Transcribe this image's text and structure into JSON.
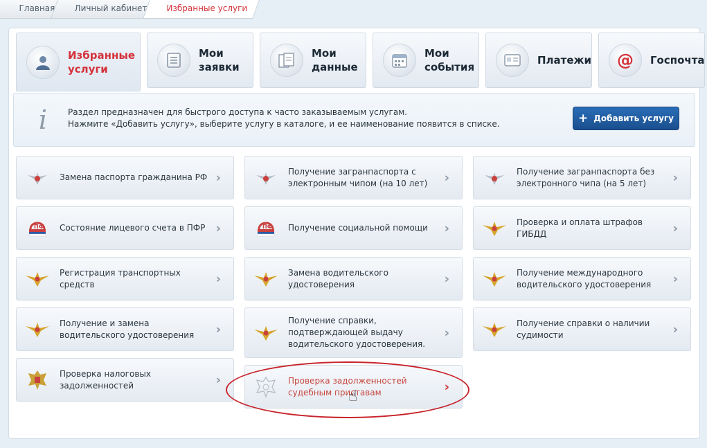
{
  "breadcrumb": {
    "items": [
      "Главная",
      "Личный кабинет",
      "Избранные услуги"
    ]
  },
  "tabs": [
    {
      "label": "Избранные услуги",
      "icon": "user-icon",
      "active": true
    },
    {
      "label": "Мои заявки",
      "icon": "list-icon"
    },
    {
      "label": "Мои данные",
      "icon": "documents-icon"
    },
    {
      "label": "Мои события",
      "icon": "calendar-icon"
    },
    {
      "label": "Платежи",
      "icon": "card-icon"
    },
    {
      "label": "Госпочта",
      "icon": "at-icon"
    }
  ],
  "info": {
    "line1": "Раздел предназначен для быстрого доступа к часто заказываемым услугам.",
    "line2": "Нажмите «Добавить услугу», выберите услугу в каталоге, и ее наименование появится в списке.",
    "add_button": "Добавить услугу"
  },
  "services": [
    {
      "label": "Замена паспорта гражданина РФ",
      "icon": "fms-emblem-icon"
    },
    {
      "label": "Получение загранпаспорта с электронным чипом (на 10 лет)",
      "icon": "fms-emblem-icon"
    },
    {
      "label": "Получение загранпаспорта без электронного чипа (на 5 лет)",
      "icon": "fms-emblem-icon"
    },
    {
      "label": "Состояние лицевого счета в ПФР",
      "icon": "pfr-logo-icon"
    },
    {
      "label": "Получение социальной помощи",
      "icon": "pfr-logo-icon"
    },
    {
      "label": "Проверка и оплата штрафов ГИБДД",
      "icon": "mvd-emblem-icon"
    },
    {
      "label": "Регистрация транспортных средств",
      "icon": "mvd-emblem-icon"
    },
    {
      "label": "Замена водительского удостоверения",
      "icon": "mvd-emblem-icon"
    },
    {
      "label": "Получение международного водительского удостоверения",
      "icon": "mvd-emblem-icon"
    },
    {
      "label": "Получение и замена водительского удостоверения",
      "icon": "mvd-emblem-icon"
    },
    {
      "label": "Получение справки, подтверждающей выдачу водительского удостоверения.",
      "icon": "mvd-emblem-icon"
    },
    {
      "label": "Получение справки о наличии судимости",
      "icon": "mvd-emblem-icon"
    },
    {
      "label": "Проверка налоговых задолженностей",
      "icon": "fns-eagle-icon"
    },
    {
      "label": "Проверка задолженностей судебным приставам",
      "icon": "fssp-eagle-icon",
      "highlighted": true
    }
  ],
  "colors": {
    "accent_red": "#d4323b",
    "button_blue": "#1f5ea4",
    "highlight_ring": "#c8242b"
  }
}
